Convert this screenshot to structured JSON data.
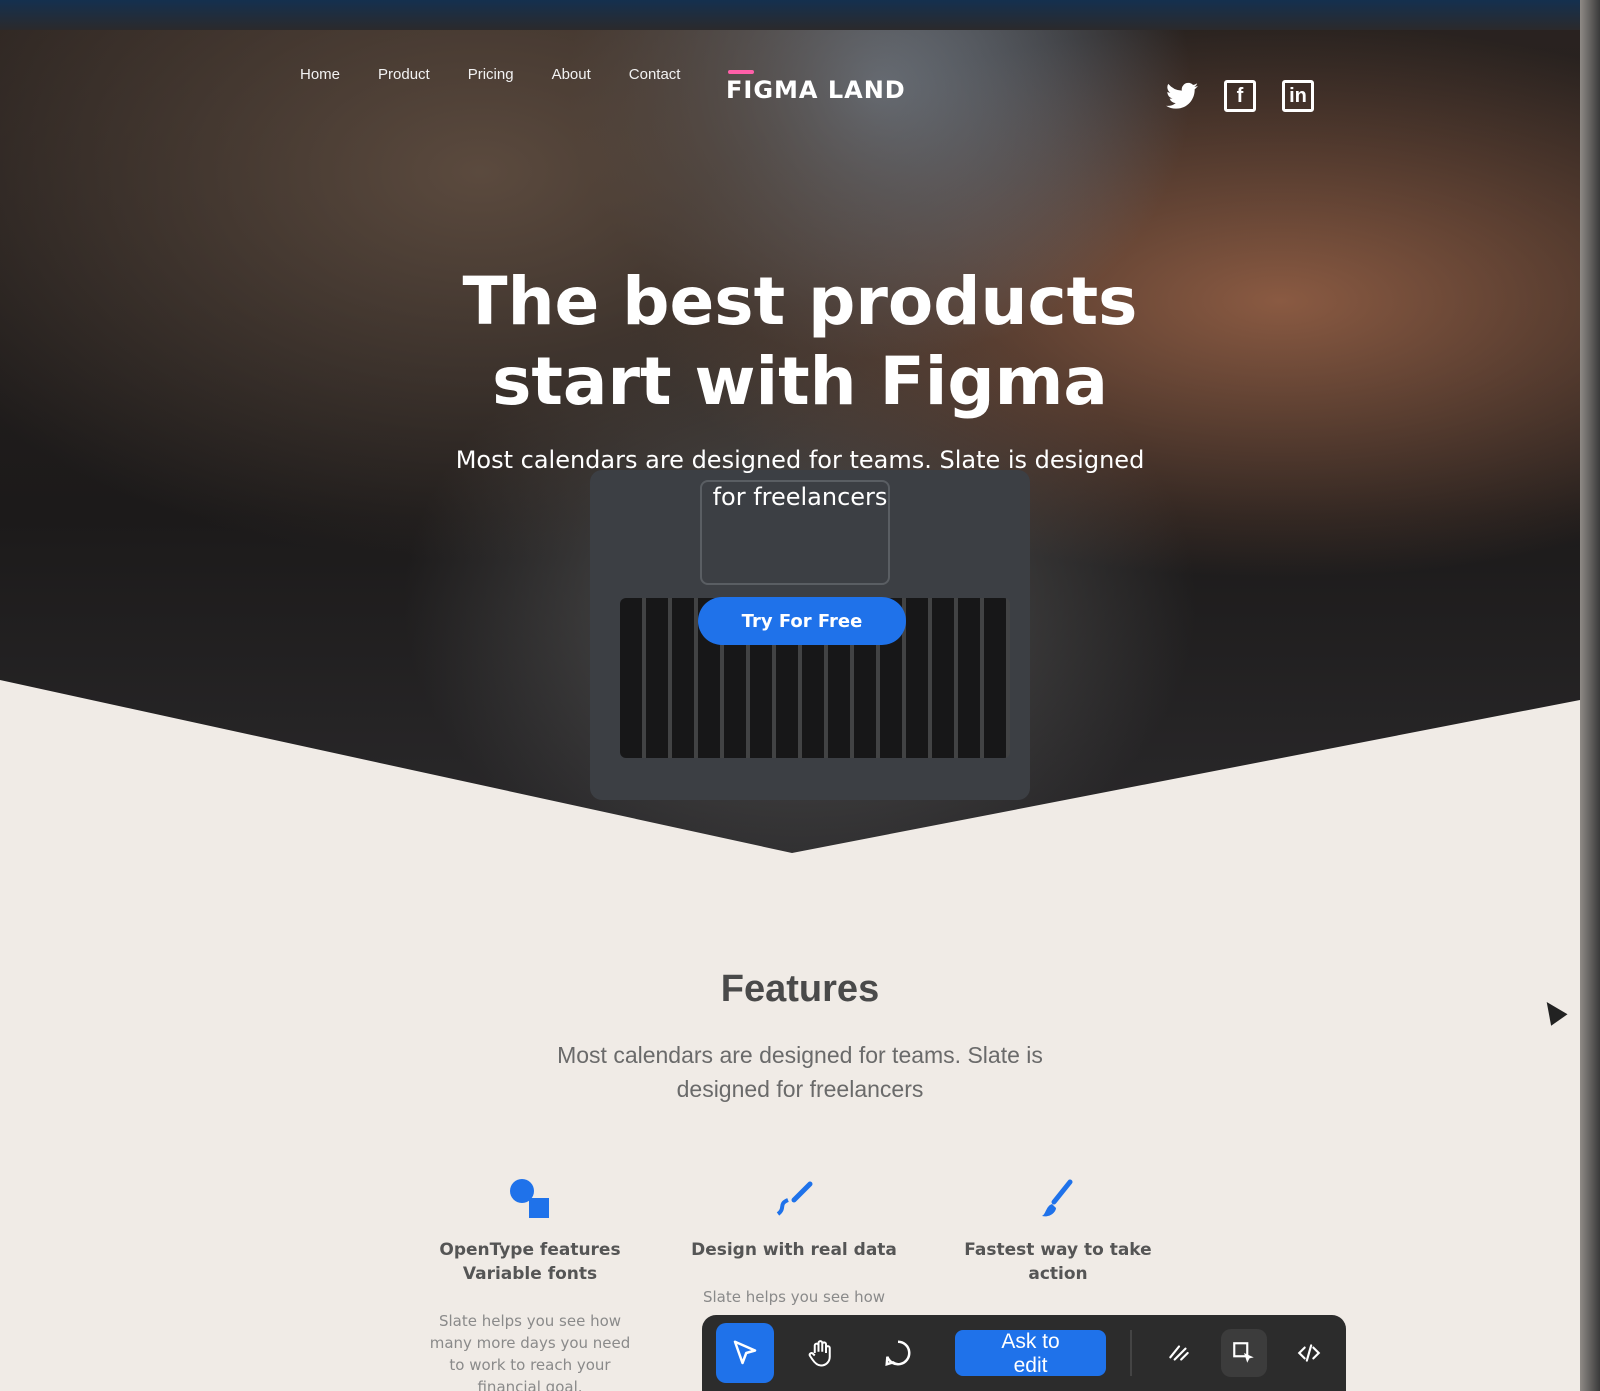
{
  "nav": {
    "items": [
      "Home",
      "Product",
      "Pricing",
      "About",
      "Contact"
    ]
  },
  "logo": {
    "text": "FIGMA LAND"
  },
  "social": {
    "twitter": "twitter-icon",
    "facebook": "f",
    "linkedin": "in"
  },
  "hero": {
    "title": "The best products start with Figma",
    "subtitle": "Most calendars are designed for teams. Slate is designed for freelancers",
    "cta": "Try For Free"
  },
  "features": {
    "title": "Features",
    "subtitle": "Most calendars are designed for teams. Slate is designed for freelancers",
    "items": [
      {
        "title": "OpenType features Variable fonts",
        "body": "Slate helps you see how many more days you need to work to reach your financial goal.",
        "icon": "shapes-icon"
      },
      {
        "title": "Design with real data",
        "body": "Slate helps you see how",
        "icon": "pen-draw-icon"
      },
      {
        "title": "Fastest way to take action",
        "body": "",
        "icon": "brush-icon"
      }
    ]
  },
  "toolbar": {
    "ask_to_edit": "Ask to edit",
    "tools": [
      "move-icon",
      "hand-icon",
      "comment-icon",
      "scribble-icon",
      "component-select-icon",
      "code-icon"
    ]
  },
  "colors": {
    "accent": "#1f72ea",
    "logo_bar": "#ff5fa8",
    "background_light": "#f0ebe6"
  }
}
